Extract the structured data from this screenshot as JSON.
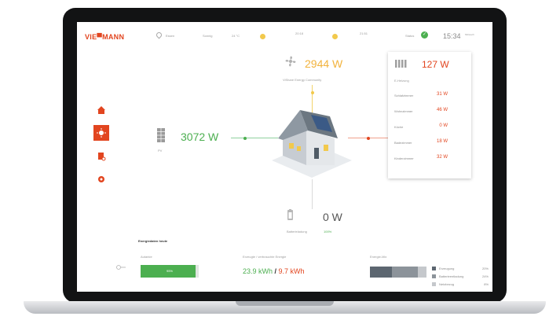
{
  "header": {
    "logo": "VIE▀MANN",
    "location": "Essen",
    "weather": "Sonnig",
    "temperature": "24 °C",
    "sun_window_1": "20:18",
    "sun_window_2": "21:51",
    "status_label": "Status",
    "time": "15:34",
    "time_sub": "Mittwoch"
  },
  "flow": {
    "grid": {
      "value": "2944 W",
      "label": "ViShare Energy Community"
    },
    "pv": {
      "value": "3072 W",
      "label": "PV"
    },
    "battery": {
      "value": "0 W",
      "label": "Batterieladung",
      "percent": "100%"
    },
    "consumer": {
      "value": "127 W",
      "label": "E-Heizung"
    }
  },
  "rooms": [
    {
      "name": "Schlafzimmer",
      "value": "31 W"
    },
    {
      "name": "Wohnzimmer",
      "value": "46 W"
    },
    {
      "name": "Küche",
      "value": "0 W"
    },
    {
      "name": "Badezimmer",
      "value": "18 W"
    },
    {
      "name": "Kinderzimmer",
      "value": "32 W"
    }
  ],
  "bottom": {
    "title": "Energiedaten heute",
    "autarky": {
      "label": "Autarkie",
      "value_text": "95%",
      "fraction": 0.95
    },
    "energy": {
      "label": "Erzeugte / verbrauchte Energie",
      "produced": "23.9 kWh",
      "slash": " / ",
      "consumed": "9.7 kWh"
    },
    "mix": {
      "label": "Energie-Mix",
      "segments": [
        {
          "name": "Erzeugung",
          "percent": "20%",
          "value": 20,
          "color": "#5c6670"
        },
        {
          "name": "Batterieentladung",
          "percent": "24%",
          "value": 24,
          "color": "#8c939a"
        },
        {
          "name": "Netzbezug",
          "percent": "8%",
          "value": 8,
          "color": "#c5c8cc"
        }
      ]
    }
  },
  "colors": {
    "accent": "#e2451f",
    "green": "#4caf50",
    "yellow": "#f2c94c"
  }
}
